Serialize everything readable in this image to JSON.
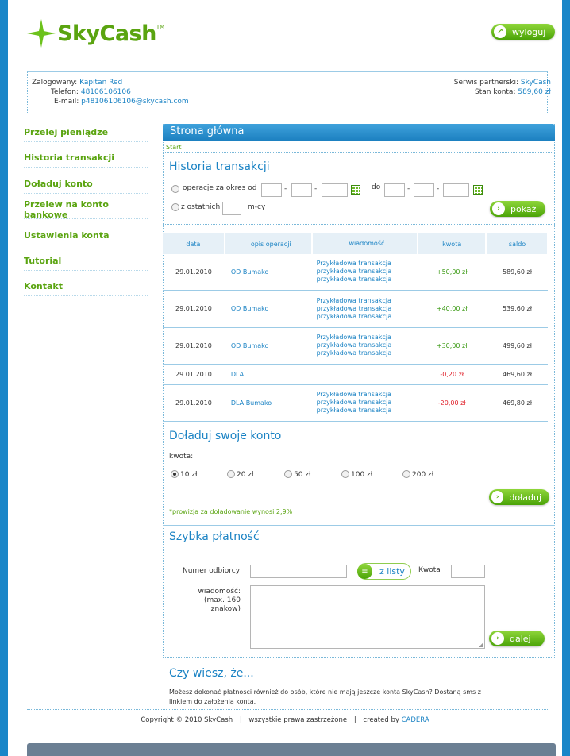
{
  "header": {
    "logo_text": "SkyCash",
    "logo_tm": "TM",
    "logout_label": "wyloguj"
  },
  "info": {
    "logged_label": "Zalogowany:",
    "logged_value": "Kapitan Red",
    "phone_label": "Telefon:",
    "phone_value": "48106106106",
    "email_label": "E-mail:",
    "email_value": "p48106106106@skycash.com",
    "partner_label": "Serwis partnerski:",
    "partner_value": "SkyCash",
    "balance_label": "Stan konta:",
    "balance_value": "589,60 zł"
  },
  "sidebar": {
    "items": [
      {
        "label": "Przelej pieniądze"
      },
      {
        "label": "Historia transakcji"
      },
      {
        "label": "Doładuj konto"
      },
      {
        "label": "Przelew na konto bankowe"
      },
      {
        "label": "Ustawienia konta"
      },
      {
        "label": "Tutorial"
      },
      {
        "label": "Kontakt"
      }
    ]
  },
  "main": {
    "title": "Strona główna",
    "breadcrumb": "Start"
  },
  "history": {
    "title": "Historia transakcji",
    "range_label": "operacje za okres od",
    "to_label": "do",
    "last_label": "z ostatnich",
    "months_label": "m-cy",
    "show_label": "pokaż",
    "columns": [
      "data",
      "opis operacji",
      "wiadomość",
      "kwota",
      "saldo"
    ],
    "rows": [
      {
        "date": "29.01.2010",
        "desc": "OD Bumako",
        "msg1": "Przykładowa transakcja",
        "msg2": "przykładowa transakcja",
        "msg3": "przykładowa transakcja",
        "amount": "+50,00 zł",
        "balance": "589,60 zł"
      },
      {
        "date": "29.01.2010",
        "desc": "OD Bumako",
        "msg1": "Przykładowa transakcja",
        "msg2": "przykładowa transakcja",
        "msg3": "przykładowa transakcja",
        "amount": "+40,00 zł",
        "balance": "539,60 zł"
      },
      {
        "date": "29.01.2010",
        "desc": "OD Bumako",
        "msg1": "Przykładowa transakcja",
        "msg2": "przykładowa transakcja",
        "msg3": "przykładowa transakcja",
        "amount": "+30,00 zł",
        "balance": "499,60 zł"
      },
      {
        "date": "29.01.2010",
        "desc": "DLA",
        "amount": "-0,20 zł",
        "balance": "469,60 zł"
      },
      {
        "date": "29.01.2010",
        "desc": "DLA Bumako",
        "msg1": "Przykładowa transakcja",
        "msg2": "przykładowa transakcja",
        "msg3": "przykładowa transakcja",
        "amount": "-20,00 zł",
        "balance": "469,80 zł"
      }
    ]
  },
  "topup": {
    "title": "Doładuj swoje konto",
    "amount_label": "kwota:",
    "options": [
      "10 zł",
      "20 zł",
      "50 zł",
      "100 zł",
      "200 zł"
    ],
    "selected": "10 zł",
    "button_label": "doładuj",
    "note": "*prowizja za doładowanie wynosi 2,9%"
  },
  "quickpay": {
    "title": "Szybka płatność",
    "recipient_label": "Numer odbiorcy",
    "from_list_label": "z listy",
    "amount_label": "Kwota",
    "message_label_1": "wiadomość:",
    "message_label_2": "(max. 160",
    "message_label_3": "znakow)",
    "next_label": "dalej"
  },
  "didyouknow": {
    "title": "Czy wiesz, że...",
    "text_1": "Możesz dokonać płatnosci również do osób, które nie mają jeszcze konta SkyCash? Dostaną sms z",
    "text_2": "linkiem do założenia konta."
  },
  "footer": {
    "copyright": "Copyright © 2010 SkyCash",
    "sep": "|",
    "rights": "wszystkie prawa zastrzeżone",
    "created_by": "created by",
    "cadera": "CADERA"
  },
  "colors": {
    "background_blue": "#1a86c8",
    "brand_green": "#5aa410",
    "link_blue": "#1b83c4",
    "negative_red": "#e0202a"
  }
}
